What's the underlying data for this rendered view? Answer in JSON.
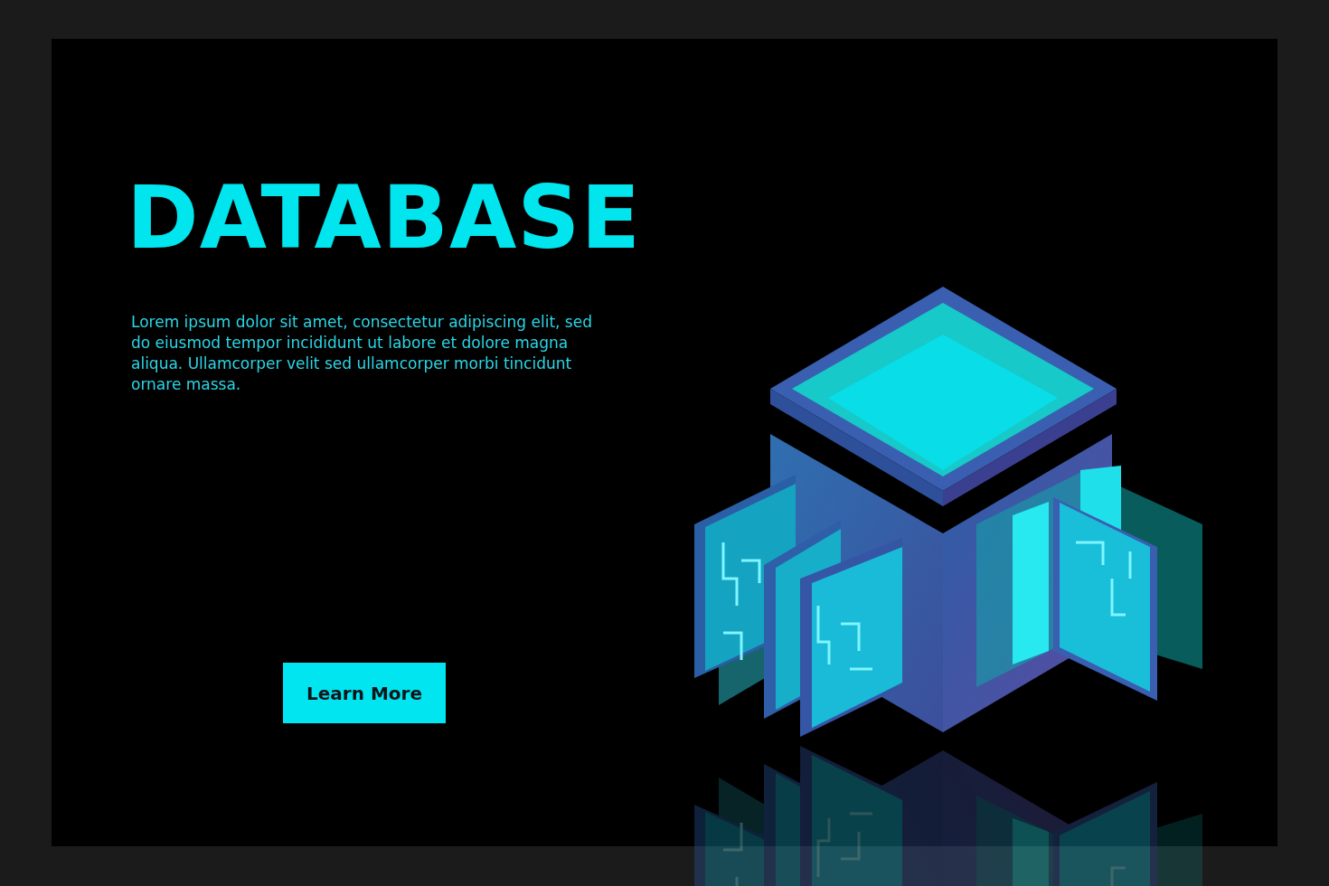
{
  "hero": {
    "title": "DATABASE",
    "description": "Lorem ipsum dolor sit amet, consectetur adipiscing elit, sed do eiusmod tempor incididunt ut labore et dolore magna aliqua. Ullamcorper velit sed ullamcorper morbi tincidunt ornare massa.",
    "button": "Learn More"
  }
}
